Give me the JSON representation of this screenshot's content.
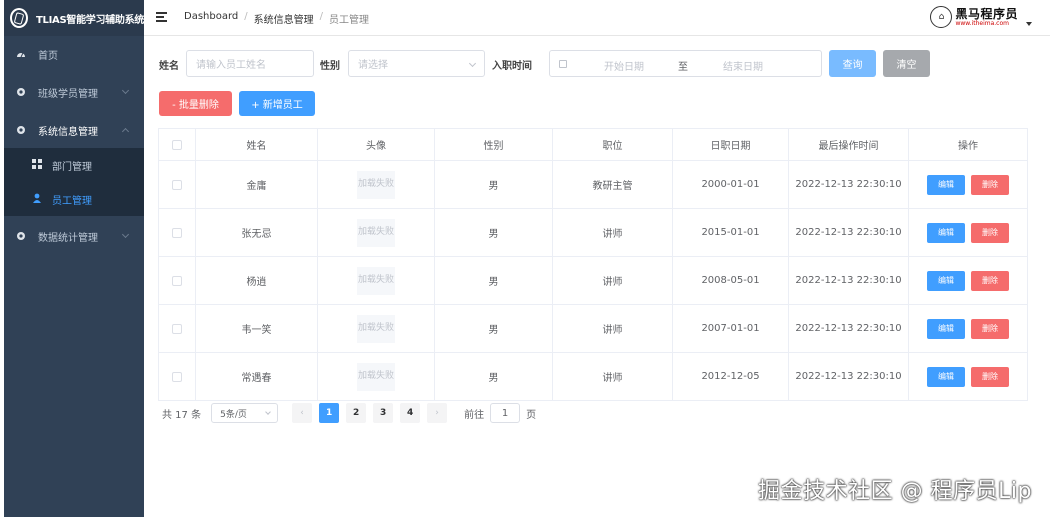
{
  "app": {
    "title": "TLIAS智能学习辅助系统"
  },
  "sidebar": {
    "items": [
      {
        "label": "首页",
        "icon": "dashboard-icon"
      },
      {
        "label": "班级学员管理",
        "icon": "gear-icon"
      },
      {
        "label": "系统信息管理",
        "icon": "gear-icon",
        "expanded": true,
        "children": [
          {
            "label": "部门管理",
            "icon": "grid-icon"
          },
          {
            "label": "员工管理",
            "icon": "user-icon",
            "active": true
          }
        ]
      },
      {
        "label": "数据统计管理",
        "icon": "gear-icon"
      }
    ]
  },
  "header": {
    "breadcrumb": [
      "Dashboard",
      "系统信息管理",
      "员工管理"
    ],
    "brand": {
      "name": "黑马程序员",
      "url": "www.itheima.com"
    }
  },
  "search": {
    "name_label": "姓名",
    "name_placeholder": "请输入员工姓名",
    "gender_label": "性别",
    "gender_placeholder": "请选择",
    "date_label": "入职时间",
    "start_placeholder": "开始日期",
    "range_sep": "至",
    "end_placeholder": "结束日期",
    "query_button": "查询",
    "clear_button": "清空"
  },
  "actions": {
    "batch_delete": "- 批量删除",
    "add_employee": "+ 新增员工"
  },
  "table": {
    "columns": [
      "",
      "姓名",
      "头像",
      "性别",
      "职位",
      "日职日期",
      "最后操作时间",
      "操作"
    ],
    "rows": [
      {
        "name": "金庸",
        "avatar": "加载失败",
        "gender": "男",
        "job": "教研主管",
        "entry_date": "2000-01-01",
        "update_time": "2022-12-13 22:30:10"
      },
      {
        "name": "张无忌",
        "avatar": "加载失败",
        "gender": "男",
        "job": "讲师",
        "entry_date": "2015-01-01",
        "update_time": "2022-12-13 22:30:10"
      },
      {
        "name": "杨逍",
        "avatar": "加载失败",
        "gender": "男",
        "job": "讲师",
        "entry_date": "2008-05-01",
        "update_time": "2022-12-13 22:30:10"
      },
      {
        "name": "韦一笑",
        "avatar": "加载失败",
        "gender": "男",
        "job": "讲师",
        "entry_date": "2007-01-01",
        "update_time": "2022-12-13 22:30:10"
      },
      {
        "name": "常遇春",
        "avatar": "加载失败",
        "gender": "男",
        "job": "讲师",
        "entry_date": "2012-12-05",
        "update_time": "2022-12-13 22:30:10"
      }
    ],
    "edit_label": "编辑",
    "delete_label": "删除"
  },
  "pagination": {
    "total_text": "共 17 条",
    "page_size": "5条/页",
    "pages": [
      "1",
      "2",
      "3",
      "4"
    ],
    "current_page": "1",
    "goto_label": "前往",
    "goto_value": "1",
    "page_suffix": "页"
  },
  "watermark": "掘金技术社区 @ 程序员Lip",
  "colors": {
    "sidebar": "#304156",
    "primary": "#409eff",
    "danger": "#f56c6c",
    "active_menu": "#409eff"
  }
}
